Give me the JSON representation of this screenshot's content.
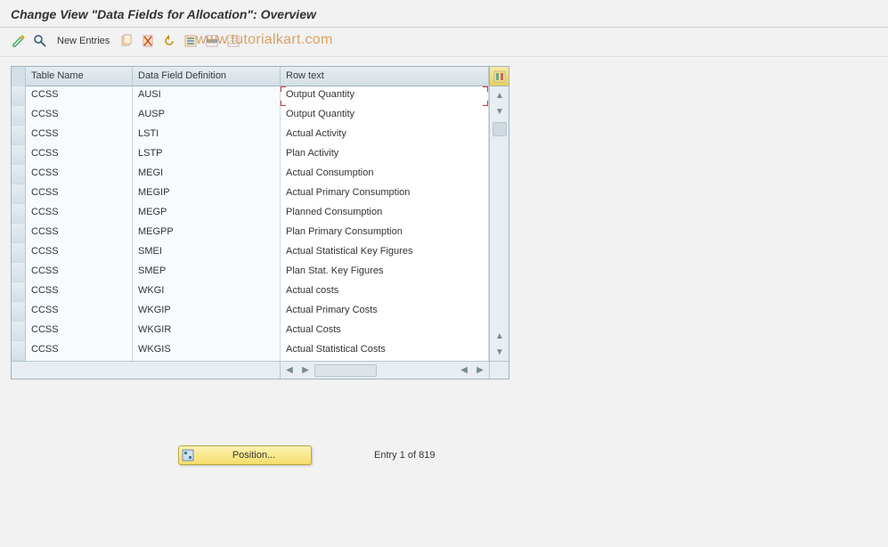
{
  "title": "Change View \"Data Fields for Allocation\": Overview",
  "toolbar": {
    "new_entries_label": "New Entries"
  },
  "watermark": "www.tutorialkart.com",
  "table": {
    "headers": {
      "col1": "Table Name",
      "col2": "Data Field Definition",
      "col3": "Row text"
    },
    "rows": [
      {
        "c1": "CCSS",
        "c2": "AUSI",
        "c3": "Output Quantity"
      },
      {
        "c1": "CCSS",
        "c2": "AUSP",
        "c3": "Output Quantity"
      },
      {
        "c1": "CCSS",
        "c2": "LSTI",
        "c3": "Actual Activity"
      },
      {
        "c1": "CCSS",
        "c2": "LSTP",
        "c3": "Plan Activity"
      },
      {
        "c1": "CCSS",
        "c2": "MEGI",
        "c3": "Actual Consumption"
      },
      {
        "c1": "CCSS",
        "c2": "MEGIP",
        "c3": "Actual Primary Consumption"
      },
      {
        "c1": "CCSS",
        "c2": "MEGP",
        "c3": "Planned Consumption"
      },
      {
        "c1": "CCSS",
        "c2": "MEGPP",
        "c3": "Plan Primary Consumption"
      },
      {
        "c1": "CCSS",
        "c2": "SMEI",
        "c3": "Actual Statistical Key Figures"
      },
      {
        "c1": "CCSS",
        "c2": "SMEP",
        "c3": "Plan Stat. Key Figures"
      },
      {
        "c1": "CCSS",
        "c2": "WKGI",
        "c3": "Actual costs"
      },
      {
        "c1": "CCSS",
        "c2": "WKGIP",
        "c3": "Actual Primary Costs"
      },
      {
        "c1": "CCSS",
        "c2": "WKGIR",
        "c3": "Actual Costs"
      },
      {
        "c1": "CCSS",
        "c2": "WKGIS",
        "c3": "Actual Statistical Costs"
      }
    ]
  },
  "footer": {
    "position_label": "Position...",
    "entry_text": "Entry 1 of 819"
  }
}
